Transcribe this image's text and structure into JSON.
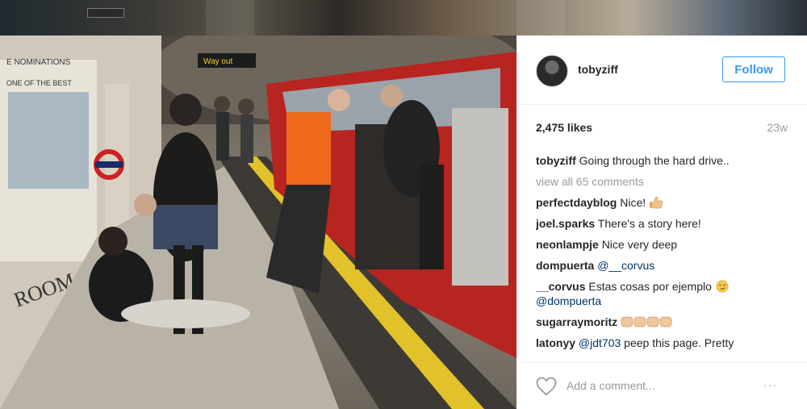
{
  "post": {
    "username": "tobyziff",
    "follow_label": "Follow",
    "likes": "2,475 likes",
    "age": "23w",
    "caption_user": "tobyziff",
    "caption_text": "Going through the hard drive..",
    "view_all": "view all 65 comments",
    "comments": [
      {
        "user": "perfectdayblog",
        "text": "Nice!",
        "emoji": "thumbs-up"
      },
      {
        "user": "joel.sparks",
        "text": "There's a story here!"
      },
      {
        "user": "neonlampje",
        "text": "Nice very deep"
      },
      {
        "user": "dompuerta",
        "mention": "@__corvus"
      },
      {
        "user": "__corvus",
        "text": "Estas cosas por ejemplo",
        "emoji": "smirk",
        "mention": "@dompuerta"
      },
      {
        "user": "sugarraymoritz",
        "emoji": "fists"
      },
      {
        "user": "latonyy",
        "mention": "@jdt703",
        "text": "peep this page. Pretty"
      }
    ],
    "add_comment_placeholder": "Add a comment...",
    "more_label": "···"
  },
  "photo_signs": {
    "way_out": "Way out",
    "nominations": "E NOMINATIONS",
    "best": "ONE OF THE BEST",
    "room": "ROOM"
  },
  "icons": {
    "like": "heart-icon",
    "more": "more-options-icon"
  },
  "colors": {
    "follow": "#3897f0",
    "mention": "#003569",
    "muted": "#999999",
    "text": "#262626"
  }
}
